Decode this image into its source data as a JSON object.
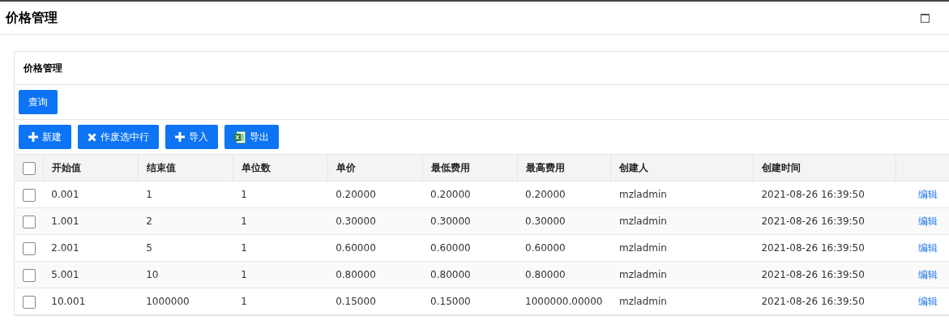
{
  "page_title": "价格管理",
  "panel": {
    "title": "价格管理",
    "query_button": "查询",
    "toolbar": [
      {
        "kind": "plus",
        "label": "新建"
      },
      {
        "kind": "cross",
        "label": "作废选中行"
      },
      {
        "kind": "plus",
        "label": "导入"
      },
      {
        "kind": "excel",
        "label": "导出"
      }
    ],
    "table": {
      "select_all": {
        "checked": false
      },
      "columns": [
        "开始值",
        "结束值",
        "单位数",
        "单价",
        "最低费用",
        "最高费用",
        "创建人",
        "创建时间"
      ],
      "rows": [
        {
          "checked": false,
          "cells": [
            "0.001",
            "1",
            "1",
            "0.20000",
            "0.20000",
            "0.20000",
            "mzladmin",
            "2021-08-26 16:39:50"
          ],
          "action": "编辑"
        },
        {
          "checked": false,
          "cells": [
            "1.001",
            "2",
            "1",
            "0.30000",
            "0.30000",
            "0.30000",
            "mzladmin",
            "2021-08-26 16:39:50"
          ],
          "action": "编辑"
        },
        {
          "checked": false,
          "cells": [
            "2.001",
            "5",
            "1",
            "0.60000",
            "0.60000",
            "0.60000",
            "mzladmin",
            "2021-08-26 16:39:50"
          ],
          "action": "编辑"
        },
        {
          "checked": false,
          "cells": [
            "5.001",
            "10",
            "1",
            "0.80000",
            "0.80000",
            "0.80000",
            "mzladmin",
            "2021-08-26 16:39:50"
          ],
          "action": "编辑"
        },
        {
          "checked": false,
          "cells": [
            "10.001",
            "1000000",
            "1",
            "0.15000",
            "0.15000",
            "1000000.00000",
            "mzladmin",
            "2021-08-26 16:39:50"
          ],
          "action": "编辑"
        }
      ]
    }
  }
}
